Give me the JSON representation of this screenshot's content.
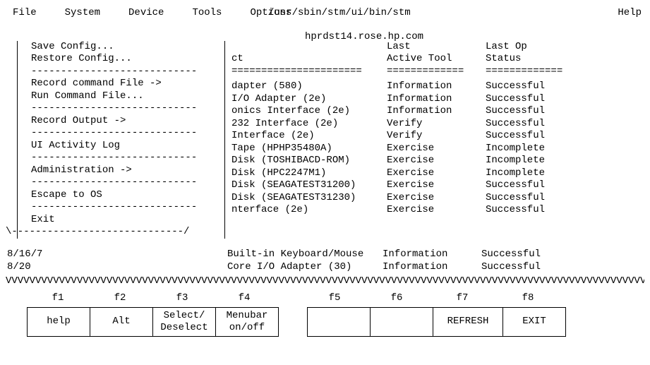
{
  "title_path": "/usr/sbin/stm/ui/bin/stm",
  "hostname": "hprdst14.rose.hp.com",
  "menubar": {
    "file": "File",
    "system": "System",
    "device": "Device",
    "tools": "Tools",
    "options": "Options",
    "help": "Help"
  },
  "file_menu": {
    "save": "Save Config...",
    "restore": "Restore Config...",
    "record_cmd": "Record command File ->",
    "run_cmd": "Run Command File...",
    "record_out": "Record Output ->",
    "ui_log": "UI Activity Log",
    "admin": "Administration ->",
    "escape": "Escape to OS",
    "exit": "Exit",
    "sep": "----------------------------"
  },
  "columns": {
    "ct": "ct",
    "last_tool_1": "Last",
    "last_tool_2": "Active Tool",
    "last_op_1": "Last Op",
    "last_op_2": "Status",
    "rule_a": "======================",
    "rule_b": "=============",
    "rule_c": "============="
  },
  "rows": [
    {
      "dev": "dapter (580)",
      "tool": "Information",
      "stat": "Successful"
    },
    {
      "dev": "I/O Adapter (2e)",
      "tool": "Information",
      "stat": "Successful"
    },
    {
      "dev": "onics Interface (2e)",
      "tool": "Information",
      "stat": "Successful"
    },
    {
      "dev": "232 Interface (2e)",
      "tool": "Verify",
      "stat": "Successful"
    },
    {
      "dev": "Interface (2e)",
      "tool": "Verify",
      "stat": "Successful"
    },
    {
      "dev": "Tape (HPHP35480A)",
      "tool": "Exercise",
      "stat": "Incomplete"
    },
    {
      "dev": "Disk (TOSHIBACD-ROM)",
      "tool": "Exercise",
      "stat": "Incomplete"
    },
    {
      "dev": "Disk (HPC2247M1)",
      "tool": "Exercise",
      "stat": "Incomplete"
    },
    {
      "dev": "Disk (SEAGATEST31200)",
      "tool": "Exercise",
      "stat": "Successful"
    },
    {
      "dev": "Disk (SEAGATEST31230)",
      "tool": "Exercise",
      "stat": "Successful"
    },
    {
      "dev": "nterface (2e)",
      "tool": "Exercise",
      "stat": "Successful"
    }
  ],
  "extra_rows": [
    {
      "path": "8/16/7",
      "dev": "Built-in Keyboard/Mouse",
      "tool": "Information",
      "stat": "Successful"
    },
    {
      "path": "8/20",
      "dev": "Core I/O Adapter (30)",
      "tool": "Information",
      "stat": "Successful"
    }
  ],
  "menu_foot": "\\-----------------------------/",
  "scroll_indicator": "VVVVVVVVVVVVVVVVVVVVVVVVVVVVVVVVVVVVVVVVVVVVVVVVVVVVVVVVVVVVVVVVVVVVVVVVVVVVVVVVVVVVVVVVVVVVVVVVVVVVVVVVVVVVVVVVVVVVVVVVVVVVVVVVVVVVVVVVVVVVVVVVVVVVVVVVVVVVVVVVVVVV",
  "fkeys": {
    "labels": [
      "f1",
      "f2",
      "f3",
      "f4",
      "f5",
      "f6",
      "f7",
      "f8"
    ],
    "f1": "help",
    "f2": "Alt",
    "f3a": "Select/",
    "f3b": "Deselect",
    "f4a": "Menubar",
    "f4b": "on/off",
    "f5": "",
    "f6": "",
    "f7": "REFRESH",
    "f8": "EXIT"
  }
}
